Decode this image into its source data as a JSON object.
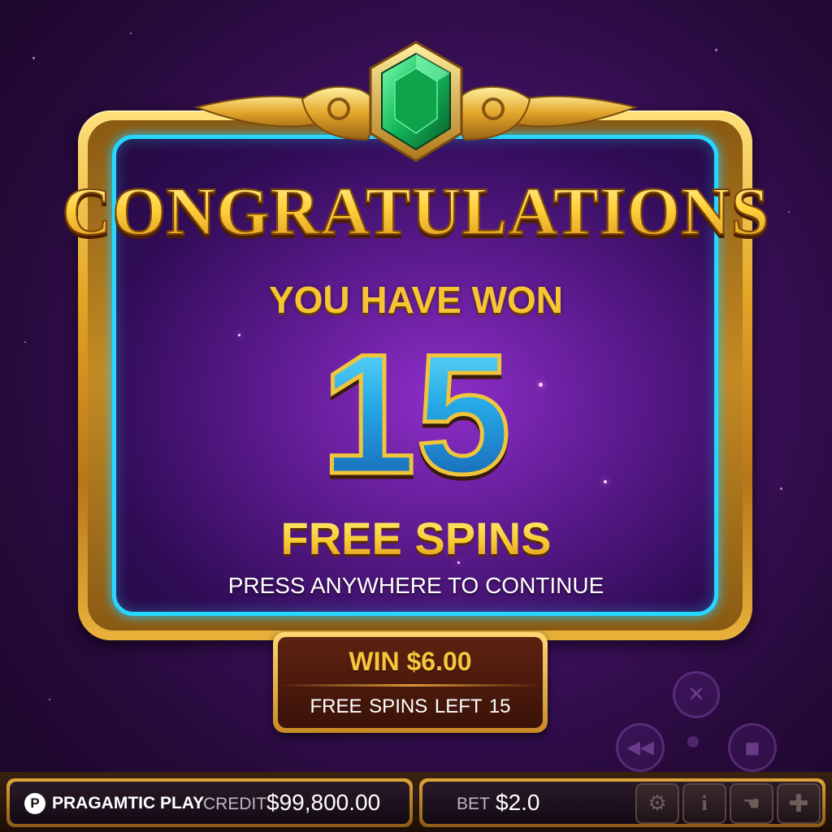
{
  "popup": {
    "title": "CONGRATULATIONS",
    "subtitle": "YOU HAVE WON",
    "spin_count": "15",
    "spins_label": "FREE SPINS",
    "instruction": "PRESS ANYWHERE TO CONTINUE"
  },
  "win_box": {
    "win_text": "WIN $6.00",
    "free_spins_left_text": "FREE SPINS LEFT  15"
  },
  "bottom_bar": {
    "brand_name": "PRAGAMTIC PLAY",
    "brand_logo_letter": "P",
    "credit_label": "CREDIT",
    "credit_value": "$99,800.00",
    "bet_label": "BET",
    "bet_value": "$2.0",
    "tools": [
      "gear-icon",
      "info-icon",
      "hand-icon",
      "plus-icon"
    ]
  },
  "colors": {
    "background": "#3f1160",
    "frame_gold": "#e2a526",
    "neon_border": "#27d7ff",
    "title_gold": "#ffd23c",
    "number_blue": "#26a8e6",
    "win_panel": "#5e2210"
  }
}
